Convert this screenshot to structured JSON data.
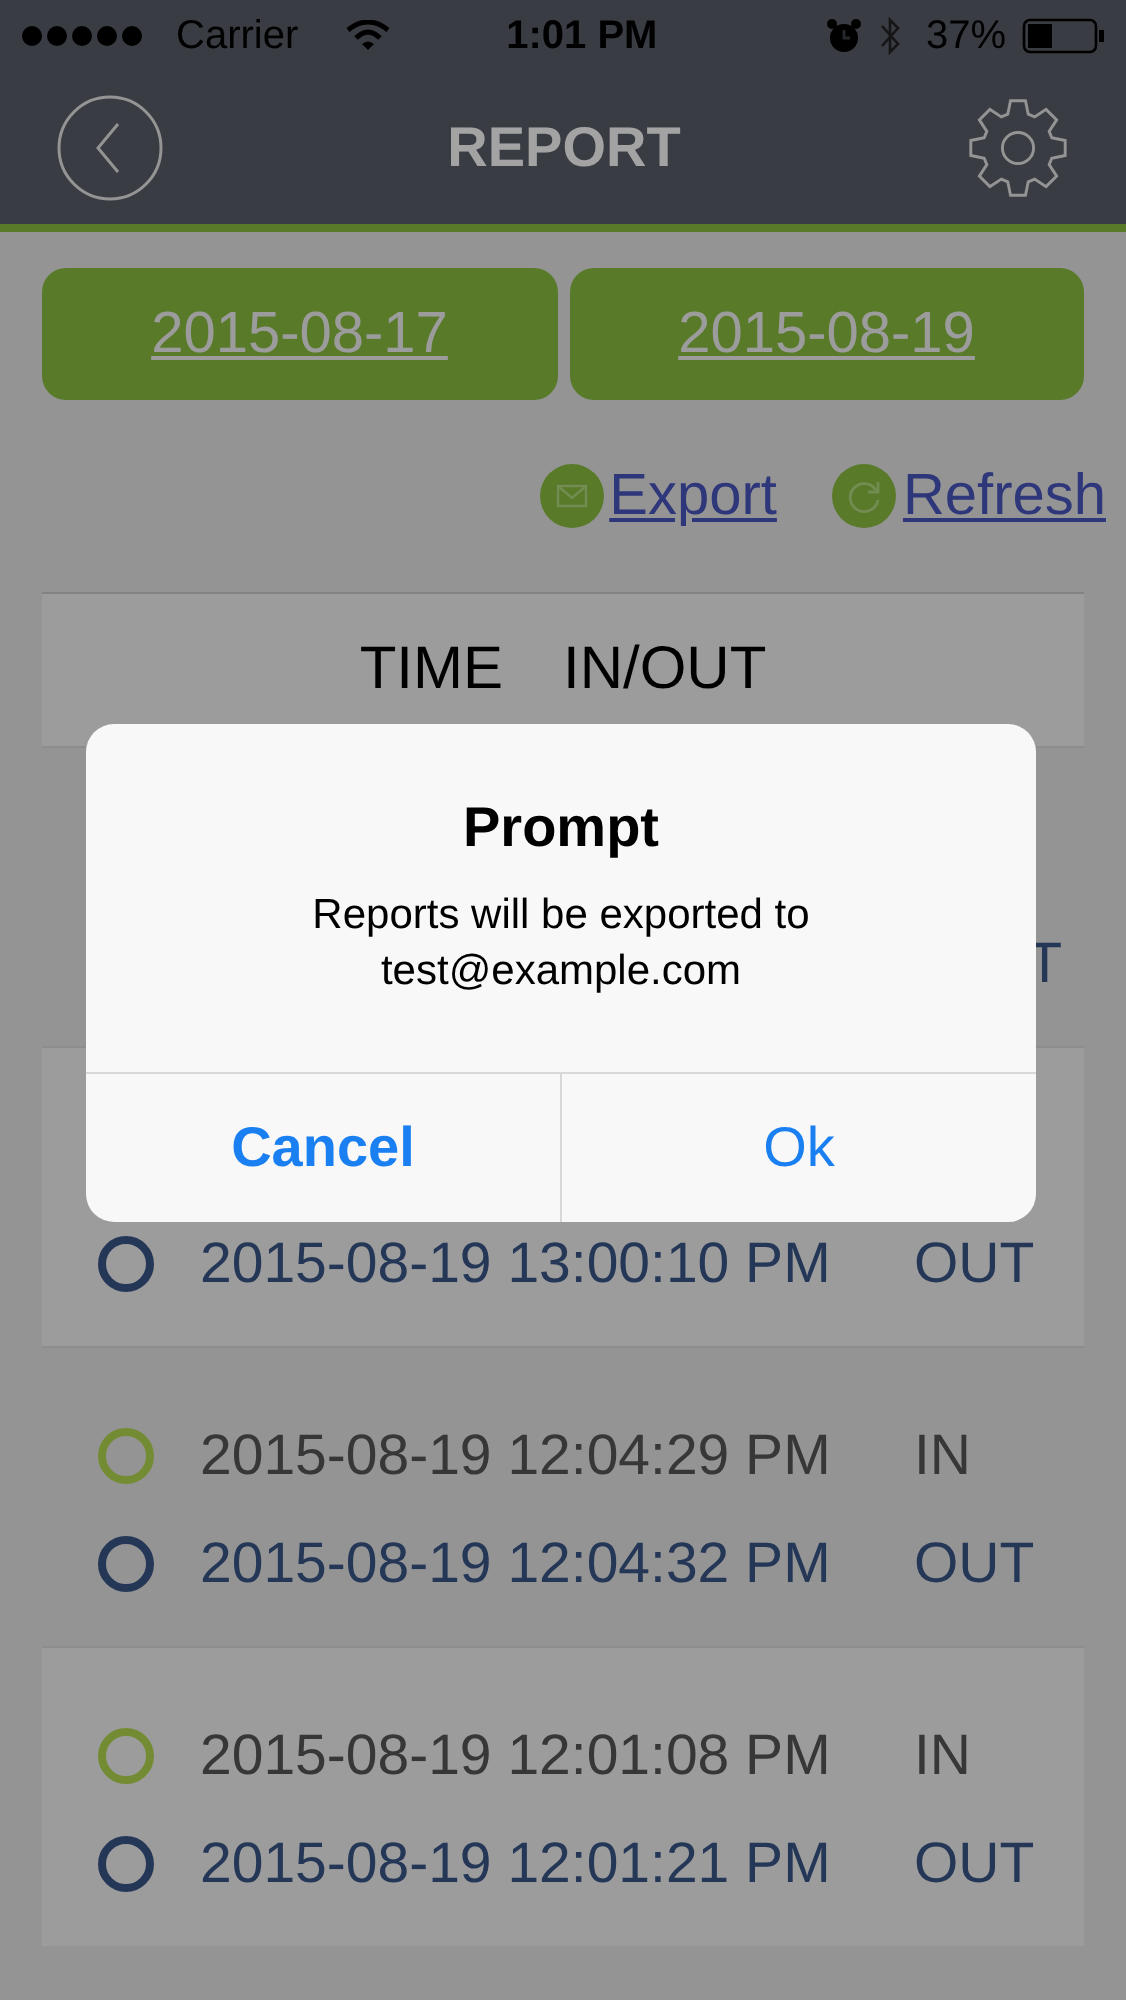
{
  "status_bar": {
    "carrier": "Carrier",
    "time": "1:01 PM",
    "battery": "37%"
  },
  "nav": {
    "title": "REPORT"
  },
  "date_range": [
    {
      "label": "2015-08-17"
    },
    {
      "label": "2015-08-19"
    }
  ],
  "actions": [
    {
      "label": "Export",
      "kind": "export"
    },
    {
      "label": "Refresh",
      "kind": "refresh"
    }
  ],
  "table": {
    "columns": [
      "TIME",
      "IN/OUT"
    ],
    "groups": [
      {
        "entries": [
          {
            "kind": "out",
            "direction": "T"
          }
        ]
      },
      {
        "entries": [
          {
            "kind": "out",
            "time": "2015-08-19 13:00:10 PM",
            "direction": "OUT"
          }
        ]
      },
      {
        "entries": [
          {
            "kind": "in",
            "time": "2015-08-19 12:04:29 PM",
            "direction": "IN"
          },
          {
            "kind": "out",
            "time": "2015-08-19 12:04:32 PM",
            "direction": "OUT"
          }
        ]
      },
      {
        "entries": [
          {
            "kind": "in",
            "time": "2015-08-19 12:01:08 PM",
            "direction": "IN"
          },
          {
            "kind": "out",
            "time": "2015-08-19 12:01:21 PM",
            "direction": "OUT"
          }
        ]
      }
    ]
  },
  "dialog": {
    "title": "Prompt",
    "message": "Reports will be exported to test@example.com",
    "buttons": [
      {
        "label": "Cancel",
        "kind": "cancel"
      },
      {
        "label": "Ok",
        "kind": "ok"
      }
    ]
  }
}
